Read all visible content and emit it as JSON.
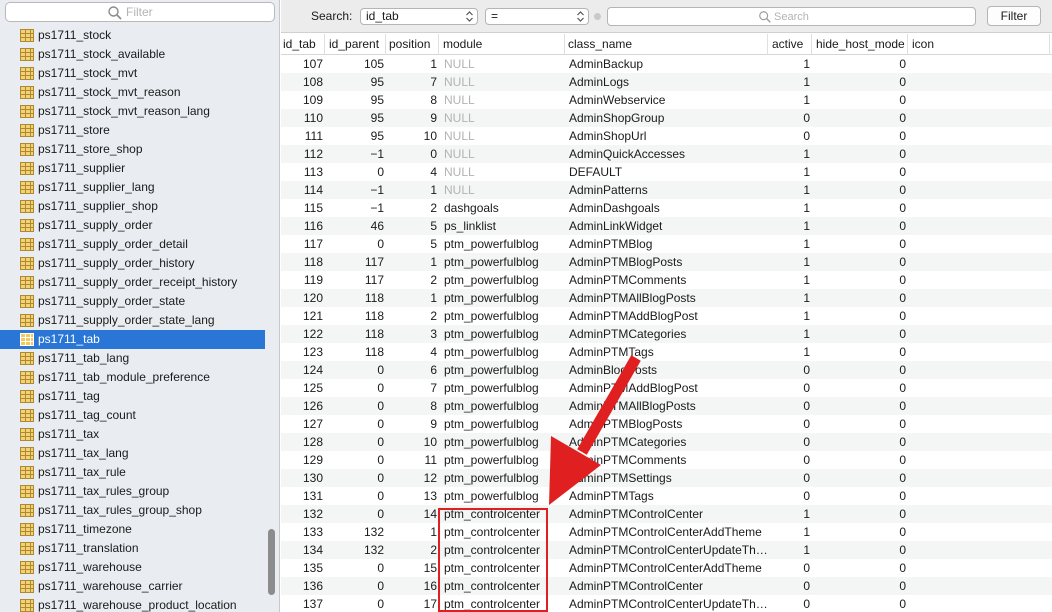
{
  "sidebar": {
    "filter_placeholder": "Filter",
    "selected": "ps1711_tab",
    "tables": [
      "ps1711_stock",
      "ps1711_stock_available",
      "ps1711_stock_mvt",
      "ps1711_stock_mvt_reason",
      "ps1711_stock_mvt_reason_lang",
      "ps1711_store",
      "ps1711_store_shop",
      "ps1711_supplier",
      "ps1711_supplier_lang",
      "ps1711_supplier_shop",
      "ps1711_supply_order",
      "ps1711_supply_order_detail",
      "ps1711_supply_order_history",
      "ps1711_supply_order_receipt_history",
      "ps1711_supply_order_state",
      "ps1711_supply_order_state_lang",
      "ps1711_tab",
      "ps1711_tab_lang",
      "ps1711_tab_module_preference",
      "ps1711_tag",
      "ps1711_tag_count",
      "ps1711_tax",
      "ps1711_tax_lang",
      "ps1711_tax_rule",
      "ps1711_tax_rules_group",
      "ps1711_tax_rules_group_shop",
      "ps1711_timezone",
      "ps1711_translation",
      "ps1711_warehouse",
      "ps1711_warehouse_carrier",
      "ps1711_warehouse_product_location"
    ]
  },
  "search": {
    "label": "Search:",
    "field": "id_tab",
    "operator": "=",
    "placeholder": "Search",
    "filter_label": "Filter"
  },
  "grid": {
    "columns": [
      "id_tab",
      "id_parent",
      "position",
      "module",
      "class_name",
      "active",
      "hide_host_mode",
      "icon"
    ],
    "rows": [
      [
        "107",
        "105",
        "1",
        "NULL",
        "AdminBackup",
        "1",
        "0",
        ""
      ],
      [
        "108",
        "95",
        "7",
        "NULL",
        "AdminLogs",
        "1",
        "0",
        ""
      ],
      [
        "109",
        "95",
        "8",
        "NULL",
        "AdminWebservice",
        "1",
        "0",
        ""
      ],
      [
        "110",
        "95",
        "9",
        "NULL",
        "AdminShopGroup",
        "0",
        "0",
        ""
      ],
      [
        "111",
        "95",
        "10",
        "NULL",
        "AdminShopUrl",
        "0",
        "0",
        ""
      ],
      [
        "112",
        "−1",
        "0",
        "NULL",
        "AdminQuickAccesses",
        "1",
        "0",
        ""
      ],
      [
        "113",
        "0",
        "4",
        "NULL",
        "DEFAULT",
        "1",
        "0",
        ""
      ],
      [
        "114",
        "−1",
        "1",
        "NULL",
        "AdminPatterns",
        "1",
        "0",
        ""
      ],
      [
        "115",
        "−1",
        "2",
        "dashgoals",
        "AdminDashgoals",
        "1",
        "0",
        ""
      ],
      [
        "116",
        "46",
        "5",
        "ps_linklist",
        "AdminLinkWidget",
        "1",
        "0",
        ""
      ],
      [
        "117",
        "0",
        "5",
        "ptm_powerfulblog",
        "AdminPTMBlog",
        "1",
        "0",
        ""
      ],
      [
        "118",
        "117",
        "1",
        "ptm_powerfulblog",
        "AdminPTMBlogPosts",
        "1",
        "0",
        ""
      ],
      [
        "119",
        "117",
        "2",
        "ptm_powerfulblog",
        "AdminPTMComments",
        "1",
        "0",
        ""
      ],
      [
        "120",
        "118",
        "1",
        "ptm_powerfulblog",
        "AdminPTMAllBlogPosts",
        "1",
        "0",
        ""
      ],
      [
        "121",
        "118",
        "2",
        "ptm_powerfulblog",
        "AdminPTMAddBlogPost",
        "1",
        "0",
        ""
      ],
      [
        "122",
        "118",
        "3",
        "ptm_powerfulblog",
        "AdminPTMCategories",
        "1",
        "0",
        ""
      ],
      [
        "123",
        "118",
        "4",
        "ptm_powerfulblog",
        "AdminPTMTags",
        "1",
        "0",
        ""
      ],
      [
        "124",
        "0",
        "6",
        "ptm_powerfulblog",
        "AdminBlogPosts",
        "0",
        "0",
        ""
      ],
      [
        "125",
        "0",
        "7",
        "ptm_powerfulblog",
        "AdminPTMAddBlogPost",
        "0",
        "0",
        ""
      ],
      [
        "126",
        "0",
        "8",
        "ptm_powerfulblog",
        "AdminPTMAllBlogPosts",
        "0",
        "0",
        ""
      ],
      [
        "127",
        "0",
        "9",
        "ptm_powerfulblog",
        "AdminPTMBlogPosts",
        "0",
        "0",
        ""
      ],
      [
        "128",
        "0",
        "10",
        "ptm_powerfulblog",
        "AdminPTMCategories",
        "0",
        "0",
        ""
      ],
      [
        "129",
        "0",
        "11",
        "ptm_powerfulblog",
        "AdminPTMComments",
        "0",
        "0",
        ""
      ],
      [
        "130",
        "0",
        "12",
        "ptm_powerfulblog",
        "AdminPTMSettings",
        "0",
        "0",
        ""
      ],
      [
        "131",
        "0",
        "13",
        "ptm_powerfulblog",
        "AdminPTMTags",
        "0",
        "0",
        ""
      ],
      [
        "132",
        "0",
        "14",
        "ptm_controlcenter",
        "AdminPTMControlCenter",
        "1",
        "0",
        ""
      ],
      [
        "133",
        "132",
        "1",
        "ptm_controlcenter",
        "AdminPTMControlCenterAddTheme",
        "1",
        "0",
        ""
      ],
      [
        "134",
        "132",
        "2",
        "ptm_controlcenter",
        "AdminPTMControlCenterUpdateTh…",
        "1",
        "0",
        ""
      ],
      [
        "135",
        "0",
        "15",
        "ptm_controlcenter",
        "AdminPTMControlCenterAddTheme",
        "0",
        "0",
        ""
      ],
      [
        "136",
        "0",
        "16",
        "ptm_controlcenter",
        "AdminPTMControlCenter",
        "0",
        "0",
        ""
      ],
      [
        "137",
        "0",
        "17",
        "ptm_controlcenter",
        "AdminPTMControlCenterUpdateTh…",
        "0",
        "0",
        ""
      ]
    ]
  },
  "colors": {
    "selection": "#2a76d6",
    "annotation": "#e02020"
  }
}
